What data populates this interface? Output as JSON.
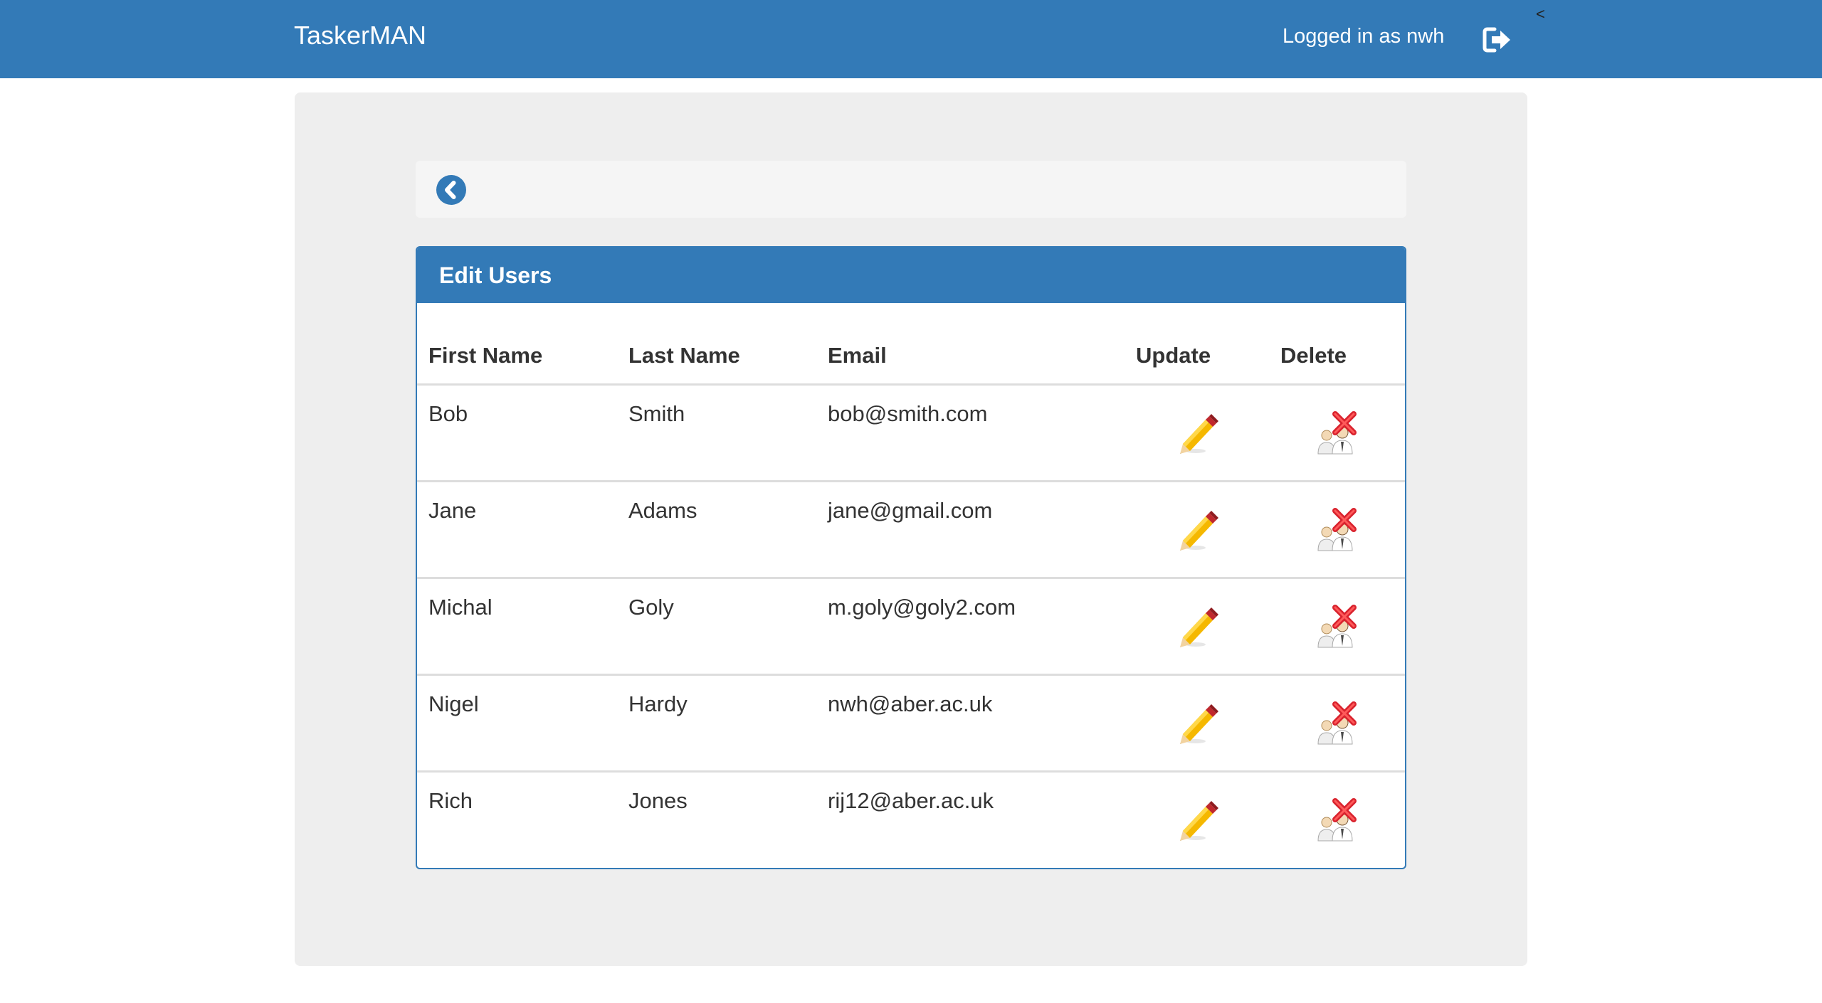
{
  "navbar": {
    "brand": "TaskerMAN",
    "logged_in_text": "Logged in as nwh",
    "logout_icon": "sign-out-icon",
    "corner_mark": "<"
  },
  "back": {
    "icon": "chevron-circle-left-icon"
  },
  "panel": {
    "title": "Edit Users",
    "columns": {
      "first_name": "First Name",
      "last_name": "Last Name",
      "email": "Email",
      "update": "Update",
      "delete": "Delete"
    },
    "update_icon": "pencil-icon",
    "delete_icon": "delete-user-icon",
    "rows": [
      {
        "first": "Bob",
        "last": "Smith",
        "email": "bob@smith.com"
      },
      {
        "first": "Jane",
        "last": "Adams",
        "email": "jane@gmail.com"
      },
      {
        "first": "Michal",
        "last": "Goly",
        "email": "m.goly@goly2.com"
      },
      {
        "first": "Nigel",
        "last": "Hardy",
        "email": "nwh@aber.ac.uk"
      },
      {
        "first": "Rich",
        "last": "Jones",
        "email": "rij12@aber.ac.uk"
      }
    ]
  },
  "colors": {
    "primary": "#337ab7",
    "well": "#eeeeee",
    "pencil_body": "#f5b800",
    "pencil_tip_red": "#c0282d",
    "delete_x": "#d9232e"
  }
}
